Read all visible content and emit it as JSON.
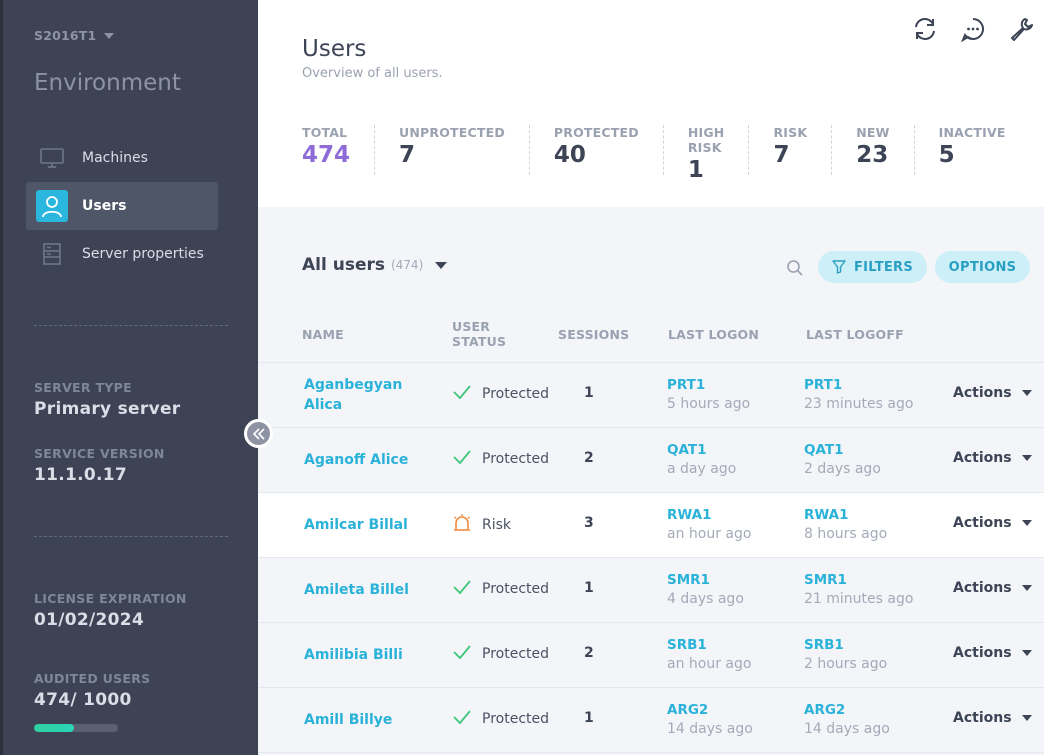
{
  "sidebar": {
    "server_name": "S2016T1",
    "environment_title": "Environment",
    "nav": [
      {
        "label": "Machines",
        "icon": "monitor-icon",
        "active": false
      },
      {
        "label": "Users",
        "icon": "user-icon",
        "active": true
      },
      {
        "label": "Server properties",
        "icon": "server-icon",
        "active": false
      }
    ],
    "server_type_label": "SERVER TYPE",
    "server_type_value": "Primary server",
    "service_version_label": "SERVICE VERSION",
    "service_version_value": "11.1.0.17",
    "license_expiration_label": "LICENSE EXPIRATION",
    "license_expiration_value": "01/02/2024",
    "audited_users_label": "AUDITED USERS",
    "audited_users_value": "474/ 1000",
    "audited_users_fraction": 0.474
  },
  "header": {
    "title": "Users",
    "subtitle": "Overview of all users.",
    "icons": [
      "refresh-icon",
      "chat-icon",
      "wrench-icon"
    ]
  },
  "stats": [
    {
      "label": "TOTAL",
      "value": "474",
      "accent": "#8f6bd8"
    },
    {
      "label": "UNPROTECTED",
      "value": "7"
    },
    {
      "label": "PROTECTED",
      "value": "40"
    },
    {
      "label": "HIGH RISK",
      "value": "1"
    },
    {
      "label": "RISK",
      "value": "7"
    },
    {
      "label": "NEW",
      "value": "23"
    },
    {
      "label": "INACTIVE",
      "value": "5"
    }
  ],
  "list": {
    "title": "All users",
    "count": "(474)",
    "filters_label": "FILTERS",
    "options_label": "OPTIONS"
  },
  "table": {
    "columns": {
      "name": "NAME",
      "user_status_line1": "USER",
      "user_status_line2": "STATUS",
      "sessions": "SESSIONS",
      "last_logon": "LAST LOGON",
      "last_logoff": "LAST LOGOFF"
    },
    "rows": [
      {
        "name": "Aganbegyan Alica",
        "status": "Protected",
        "status_icon": "check-icon",
        "sessions": "1",
        "logon_host": "PRT1",
        "logon_ago": "5 hours ago",
        "logoff_host": "PRT1",
        "logoff_ago": "23 minutes ago",
        "actions": "Actions"
      },
      {
        "name": "Aganoff Alice",
        "status": "Protected",
        "status_icon": "check-icon",
        "sessions": "2",
        "logon_host": "QAT1",
        "logon_ago": "a day ago",
        "logoff_host": "QAT1",
        "logoff_ago": "2 days ago",
        "actions": "Actions"
      },
      {
        "name": "Amilcar Billal",
        "status": "Risk",
        "status_icon": "alarm-icon",
        "sessions": "3",
        "logon_host": "RWA1",
        "logon_ago": "an hour ago",
        "logoff_host": "RWA1",
        "logoff_ago": "8 hours ago",
        "actions": "Actions"
      },
      {
        "name": "Amileta Billel",
        "status": "Protected",
        "status_icon": "check-icon",
        "sessions": "1",
        "logon_host": "SMR1",
        "logon_ago": "4 days ago",
        "logoff_host": "SMR1",
        "logoff_ago": "21 minutes ago",
        "actions": "Actions"
      },
      {
        "name": "Amilibia Billi",
        "status": "Protected",
        "status_icon": "check-icon",
        "sessions": "2",
        "logon_host": "SRB1",
        "logon_ago": "an hour ago",
        "logoff_host": "SRB1",
        "logoff_ago": "2 hours ago",
        "actions": "Actions"
      },
      {
        "name": "Amill Billye",
        "status": "Protected",
        "status_icon": "check-icon",
        "sessions": "1",
        "logon_host": "ARG2",
        "logon_ago": "14 days ago",
        "logoff_host": "ARG2",
        "logoff_ago": "14 days ago",
        "actions": "Actions"
      }
    ]
  },
  "colors": {
    "sidebar_bg": "#3d4354",
    "accent_blue": "#2ab2d9",
    "accent_purple": "#8f6bd8",
    "protected_green": "#3fc77a",
    "risk_orange": "#f08a3c"
  }
}
